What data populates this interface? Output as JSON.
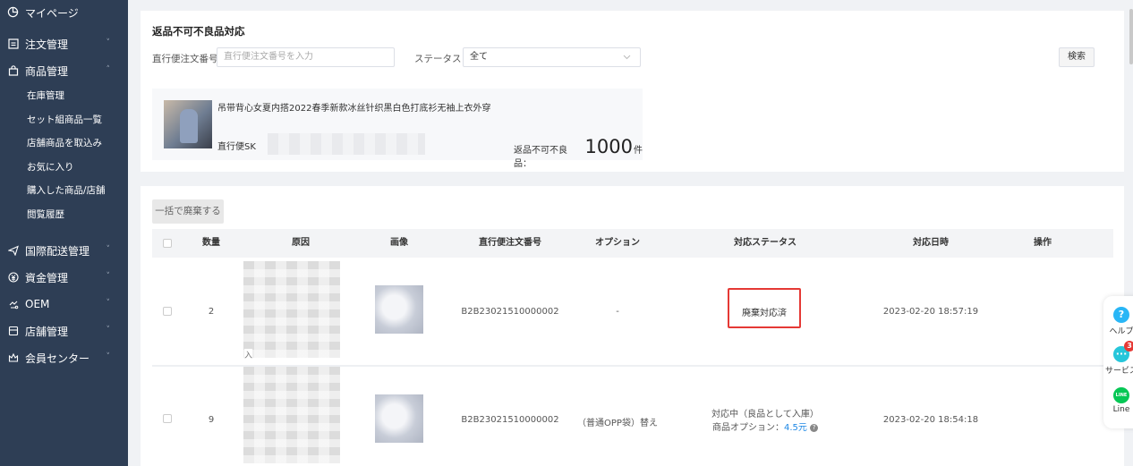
{
  "sidebar": {
    "mypage": "マイページ",
    "groups": [
      {
        "label": "注文管理",
        "icon": "order-icon",
        "chevron": "˅"
      },
      {
        "label": "商品管理",
        "icon": "shopping-bag-icon",
        "chevron": "˄"
      }
    ],
    "sub_items": [
      "在庫管理",
      "セット組商品一覧",
      "店舗商品を取込み",
      "お気に入り",
      "購入した商品/店舗",
      "閲覧履歴"
    ],
    "groups_after": [
      {
        "label": "国際配送管理",
        "icon": "send-icon",
        "chevron": "˅"
      },
      {
        "label": "資金管理",
        "icon": "money-icon",
        "chevron": "˅"
      },
      {
        "label": "OEM",
        "icon": "oem-icon",
        "chevron": "˅"
      },
      {
        "label": "店舗管理",
        "icon": "store-icon",
        "chevron": "˅"
      },
      {
        "label": "会員センター",
        "icon": "crown-icon",
        "chevron": "˅"
      }
    ]
  },
  "filter": {
    "title": "返品不可不良品対応",
    "order_no_label": "直行便注文番号",
    "order_no_placeholder": "直行便注文番号を入力",
    "status_label": "ステータス",
    "status_value": "全て",
    "search_button": "検索"
  },
  "product": {
    "name": "吊带背心女夏内搭2022春季新款冰丝针织黑白色打底衫无袖上衣外穿",
    "sku_label": "直行便SK",
    "defect_label": "返品不可不良品：",
    "defect_count": "1000",
    "defect_unit": "件"
  },
  "table": {
    "bulk_button": "一括で廃棄する",
    "headers": [
      "数量",
      "原因",
      "画像",
      "直行便注文番号",
      "オプション",
      "対応ステータス",
      "対応日時",
      "操作"
    ],
    "rows": [
      {
        "qty": "2",
        "reason_visible": "入",
        "order_no": "B2B23021510000002",
        "option": "-",
        "status": "廃棄対応済",
        "date": "2023-02-20 18:57:19"
      },
      {
        "qty": "9",
        "order_no": "B2B23021510000002",
        "option": "（普通OPP袋）替え",
        "status": "対応中（良品として入庫）",
        "status_option_label": "商品オプション：",
        "status_option_value": "4.5元",
        "date": "2023-02-20 18:54:18"
      }
    ]
  },
  "float_widget": {
    "help": "ヘルプ",
    "service": "サービス",
    "service_badge": "3",
    "line": "Line",
    "line_icon_text": "LINE"
  }
}
